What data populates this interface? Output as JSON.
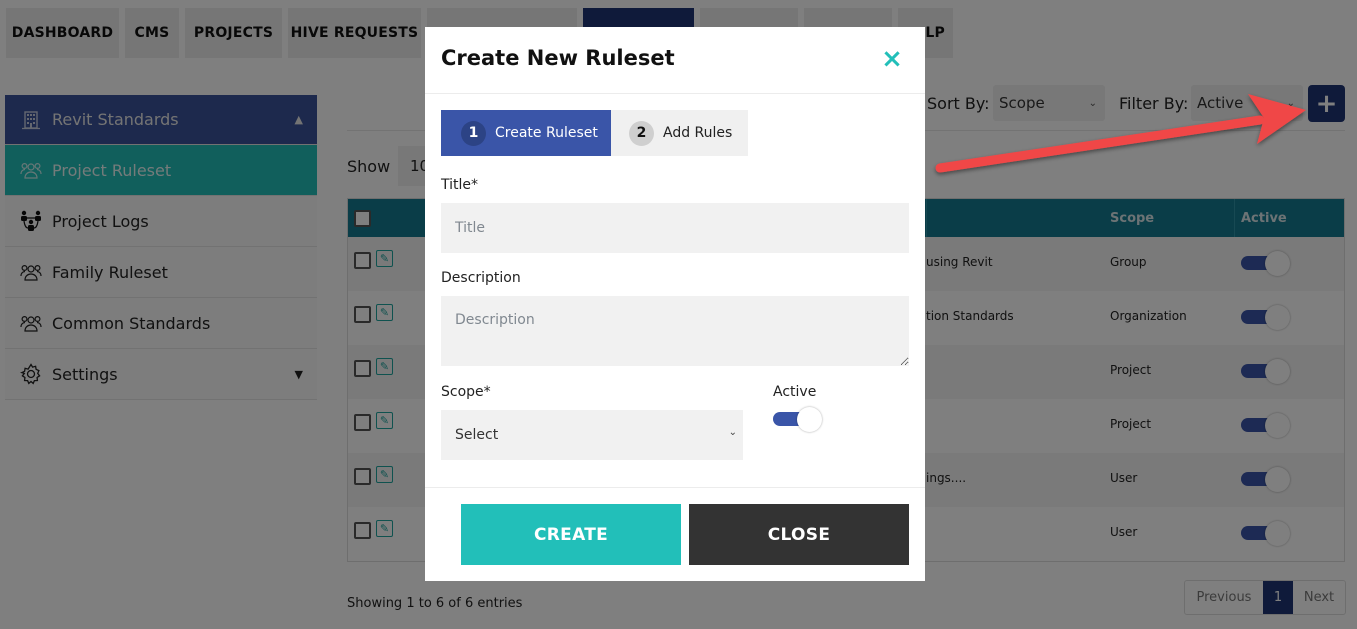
{
  "topnav": {
    "items": [
      "DASHBOARD",
      "CMS",
      "PROJECTS",
      "HIVE REQUESTS",
      "",
      "",
      "",
      "",
      "HELP"
    ],
    "visible_partial_last": "LP"
  },
  "sidebar": {
    "header": "Revit Standards",
    "items": [
      {
        "label": "Project Ruleset",
        "icon": "users-icon",
        "active": true
      },
      {
        "label": "Project Logs",
        "icon": "team-network-icon"
      },
      {
        "label": "Family Ruleset",
        "icon": "users-icon"
      },
      {
        "label": "Common Standards",
        "icon": "users-icon"
      },
      {
        "label": "Settings",
        "icon": "gear-icon"
      }
    ]
  },
  "toolbar": {
    "sort_label": "Sort By:",
    "sort_value": "Scope",
    "filter_label": "Filter By:",
    "filter_value": "Active",
    "add_button_icon": "+"
  },
  "table": {
    "show_label": "Show",
    "show_value": "10",
    "columns": [
      "Scope",
      "Active"
    ],
    "rows": [
      {
        "name": "using Revit",
        "scope": "Group",
        "active": true
      },
      {
        "name": "tion Standards",
        "scope": "Organization",
        "active": true
      },
      {
        "name": "",
        "scope": "Project",
        "active": true
      },
      {
        "name": "",
        "scope": "Project",
        "active": true
      },
      {
        "name": "ings....",
        "scope": "User",
        "active": true
      },
      {
        "name": "",
        "scope": "User",
        "active": true
      }
    ],
    "info": "Showing 1 to 6 of 6 entries",
    "pager": {
      "previous": "Previous",
      "current": "1",
      "next": "Next"
    }
  },
  "modal": {
    "title": "Create New Ruleset",
    "close_icon": "×",
    "steps": [
      {
        "num": "1",
        "label": "Create Ruleset",
        "active": true
      },
      {
        "num": "2",
        "label": "Add Rules",
        "active": false
      }
    ],
    "fields": {
      "title_label": "Title*",
      "title_placeholder": "Title",
      "description_label": "Description",
      "description_placeholder": "Description",
      "scope_label": "Scope*",
      "scope_value": "Select",
      "active_label": "Active",
      "active_value": true
    },
    "buttons": {
      "create": "CREATE",
      "close": "CLOSE"
    }
  },
  "colors": {
    "primary_navy": "#1e3475",
    "teal": "#22bfb9",
    "step_blue": "#3a55a8",
    "close_dark": "#333333",
    "arrow_red": "#f04747"
  }
}
